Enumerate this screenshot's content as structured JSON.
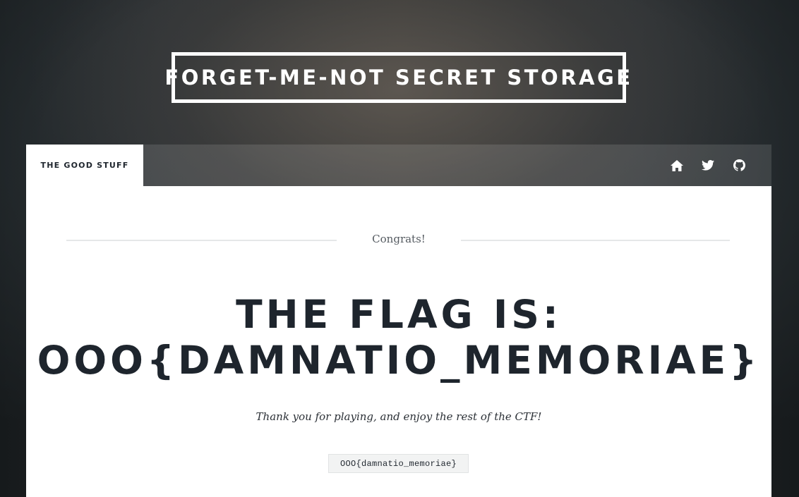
{
  "header": {
    "site_title": "Forget-me-not Secret Storage"
  },
  "nav": {
    "tab_label": "The Good Stuff",
    "icons": [
      "home-icon",
      "twitter-icon",
      "github-icon"
    ]
  },
  "main": {
    "divider_text": "Congrats!",
    "headline_line1": "The flag is:",
    "headline_line2": "OOO{damnatio_memoriae}",
    "thanks_text": "Thank you for playing, and enjoy the rest of the CTF!",
    "code_text": "OOO{damnatio_memoriae}"
  },
  "colors": {
    "accent_dark": "#1e252d",
    "white": "#ffffff",
    "divider": "#e5e7e8"
  }
}
